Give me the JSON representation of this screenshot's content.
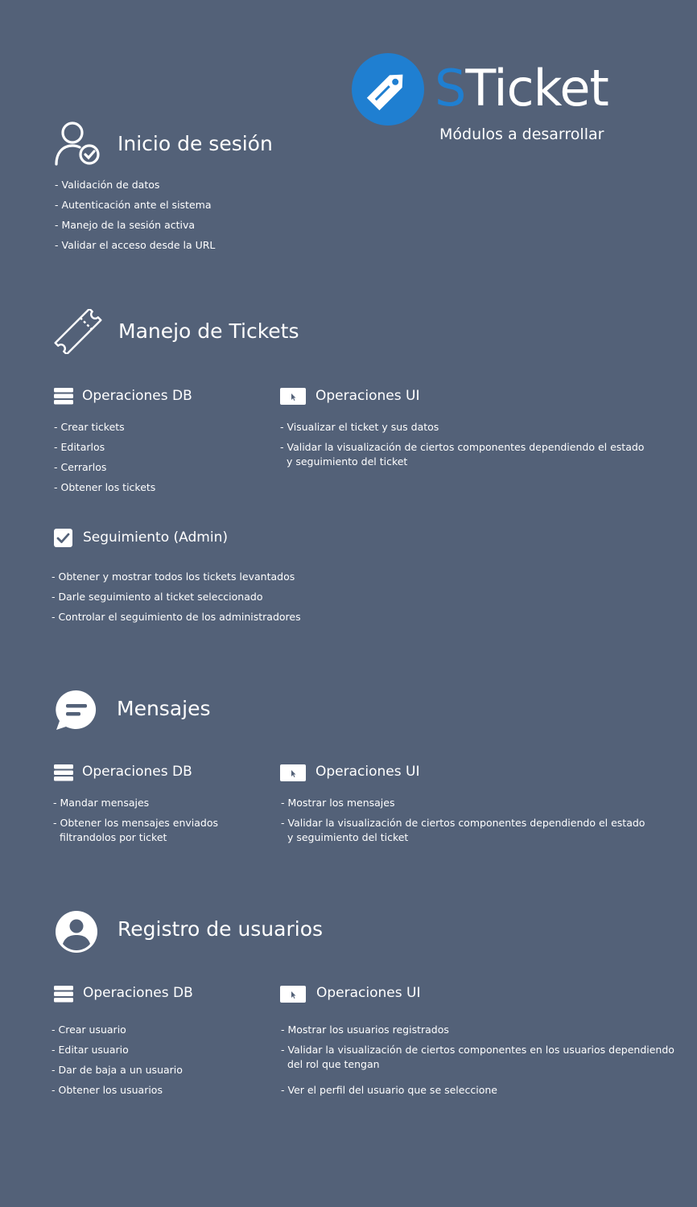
{
  "header": {
    "brand_first": "S",
    "brand_rest": "Ticket",
    "subtitle": "Módulos a desarrollar",
    "accent_color": "#1f7fd1",
    "icon": "tag-icon"
  },
  "sections": [
    {
      "title": "Inicio de sesión",
      "icon": "user-check-icon",
      "items": [
        "- Validación de datos",
        "- Autenticación ante el sistema",
        "- Manejo de la sesión activa",
        "- Validar el acceso desde la URL"
      ]
    },
    {
      "title": "Manejo de Tickets",
      "icon": "ticket-icon",
      "db": {
        "label": "Operaciones DB",
        "items": [
          "- Crear tickets",
          "- Editarlos",
          "- Cerrarlos",
          "- Obtener los tickets"
        ]
      },
      "ui": {
        "label": "Operaciones UI",
        "items": [
          "- Visualizar el ticket y sus datos",
          "- Validar la visualización de ciertos componentes dependiendo el estado\n  y seguimiento del ticket"
        ]
      },
      "admin": {
        "label": "Seguimiento (Admin)",
        "items": [
          "- Obtener y mostrar todos los tickets levantados",
          "- Darle seguimiento al ticket seleccionado",
          "- Controlar el seguimiento de los administradores"
        ]
      }
    },
    {
      "title": "Mensajes",
      "icon": "chat-icon",
      "db": {
        "label": "Operaciones DB",
        "items": [
          "- Mandar mensajes",
          "- Obtener los mensajes enviados\n  filtrandolos por ticket"
        ]
      },
      "ui": {
        "label": "Operaciones UI",
        "items": [
          "- Mostrar los mensajes",
          "- Validar la visualización de ciertos componentes dependiendo el estado\n  y seguimiento del ticket"
        ]
      }
    },
    {
      "title": "Registro de usuarios",
      "icon": "account-circle-icon",
      "db": {
        "label": "Operaciones DB",
        "items": [
          "- Crear usuario",
          "- Editar usuario",
          "- Dar de baja a un usuario",
          "- Obtener los usuarios"
        ]
      },
      "ui": {
        "label": "Operaciones UI",
        "items": [
          "- Mostrar los usuarios registrados",
          "- Validar la visualización de ciertos componentes en los usuarios dependiendo\n  del rol que tengan",
          "- Ver el perfil del usuario que se seleccione"
        ]
      }
    }
  ]
}
